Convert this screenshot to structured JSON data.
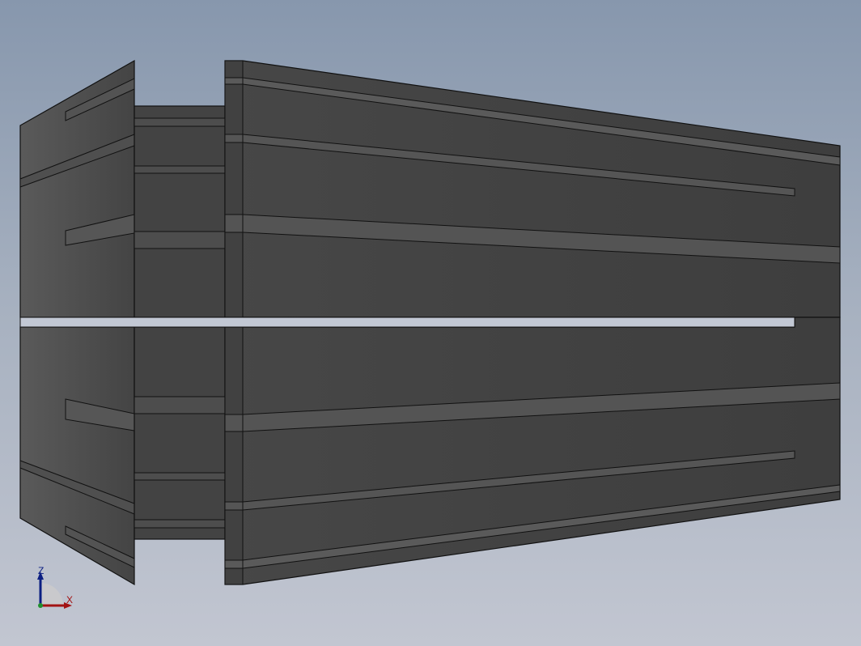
{
  "view": {
    "background_top": "#8797ad",
    "background_bottom": "#c2c6d1",
    "model_color": "#454545",
    "edge_color": "#111111"
  },
  "model": {
    "name": "",
    "icon": "collet-model-icon"
  },
  "triad": {
    "z_label": "Z",
    "x_label": "X",
    "z_color": "#0c1f82",
    "x_color": "#a31313",
    "icon": "coordinate-triad-icon"
  }
}
